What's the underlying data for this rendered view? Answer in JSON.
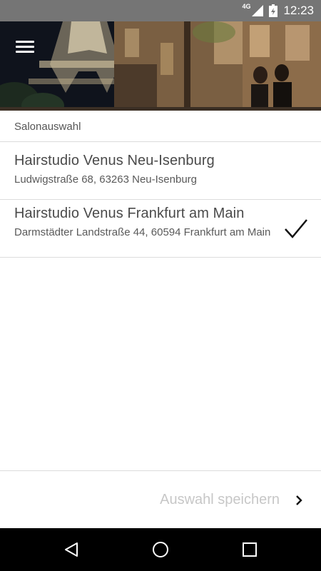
{
  "status_bar": {
    "network_label": "4G",
    "time": "12:23",
    "icons": [
      "signal-icon",
      "battery-icon"
    ]
  },
  "header": {
    "menu_icon": "hamburger-menu-icon",
    "background": "night photo of Paris street with Eiffel Tower and two women"
  },
  "section": {
    "title": "Salonauswahl"
  },
  "salons": [
    {
      "name": "Hairstudio Venus Neu-Isenburg",
      "address": "Ludwigstraße 68, 63263 Neu-Isenburg",
      "selected": false
    },
    {
      "name": "Hairstudio Venus Frankfurt am Main",
      "address": "Darmstädter Landstraße 44, 60594 Frankfurt am Main",
      "selected": true
    }
  ],
  "footer": {
    "save_label": "Auswahl speichern",
    "save_icon": "chevron-right-icon"
  },
  "nav_bar": {
    "buttons": [
      "back-icon",
      "home-icon",
      "recents-icon"
    ]
  },
  "colors": {
    "status_bar": "#757575",
    "nav_bar": "#000000",
    "divider": "#dcdcdc",
    "disabled_text": "#c7c7c7"
  }
}
